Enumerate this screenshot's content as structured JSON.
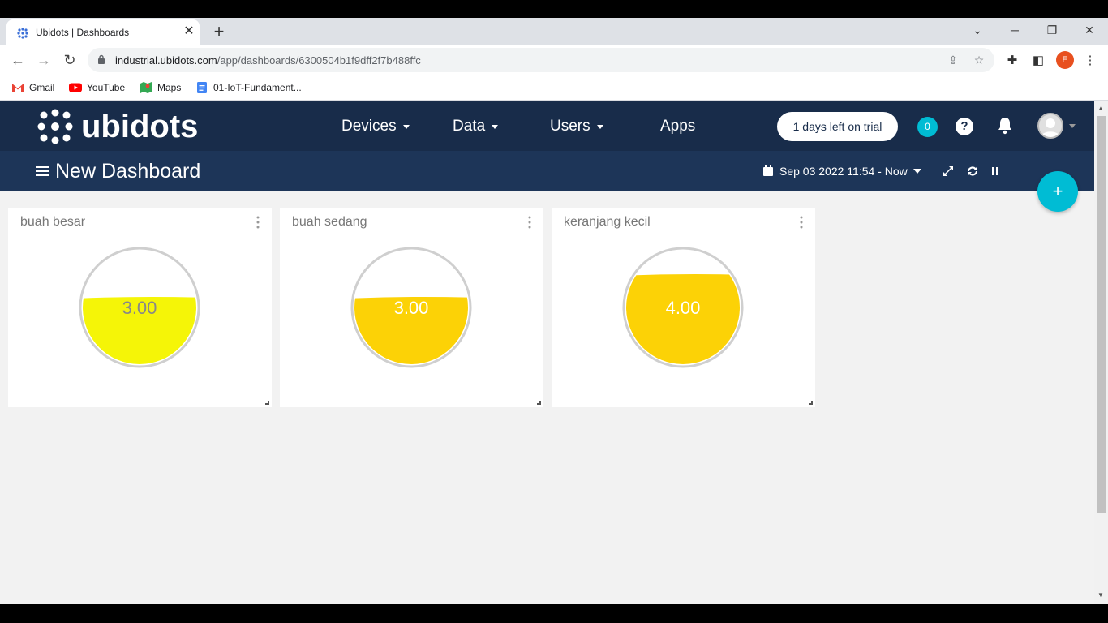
{
  "browser": {
    "tab_title": "Ubidots | Dashboards",
    "url_host": "industrial.ubidots.com",
    "url_path": "/app/dashboards/6300504b1f9dff2f7b488ffc",
    "profile_initial": "E",
    "bookmarks": [
      {
        "label": "Gmail",
        "icon": "gmail-icon"
      },
      {
        "label": "YouTube",
        "icon": "youtube-icon"
      },
      {
        "label": "Maps",
        "icon": "maps-icon"
      },
      {
        "label": "01-IoT-Fundament...",
        "icon": "doc-icon"
      }
    ]
  },
  "app": {
    "logo_text": "ubidots",
    "nav": [
      {
        "label": "Devices",
        "dropdown": true
      },
      {
        "label": "Data",
        "dropdown": true
      },
      {
        "label": "Users",
        "dropdown": true
      },
      {
        "label": "Apps",
        "dropdown": false
      }
    ],
    "trial_label": "1 days left on trial",
    "notification_count": "0",
    "help_label": "?"
  },
  "dashboard": {
    "title": "New Dashboard",
    "date_range": "Sep 03 2022 11:54 - Now",
    "fab_label": "+"
  },
  "widgets": [
    {
      "title": "buah besar",
      "value": "3.00",
      "fill_fraction": 0.58,
      "fill_color": "#f5f507"
    },
    {
      "title": "buah sedang",
      "value": "3.00",
      "fill_fraction": 0.58,
      "fill_color": "#fcd206"
    },
    {
      "title": "keranjang kecil",
      "value": "4.00",
      "fill_fraction": 0.78,
      "fill_color": "#fcd206"
    }
  ],
  "colors": {
    "topnav": "#182c4a",
    "dashbar": "#1d3558",
    "accent": "#00bcd4"
  }
}
